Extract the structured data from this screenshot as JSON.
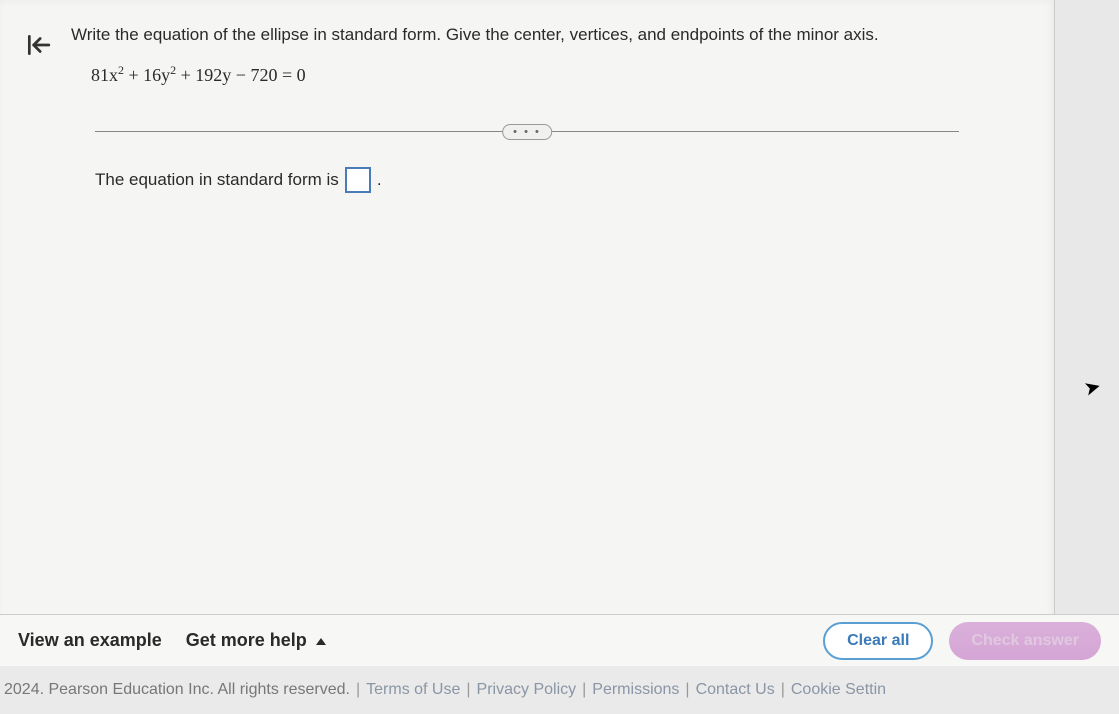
{
  "question": {
    "prompt": "Write the equation of the ellipse in standard form. Give the center, vertices, and endpoints of the minor axis.",
    "equation_html": "81x<span class='sup'>2</span> + 16y<span class='sup'>2</span> + 192y − 720 = 0"
  },
  "answer": {
    "prompt": "The equation in standard form is",
    "suffix": "."
  },
  "toolbar": {
    "view_example": "View an example",
    "get_more_help": "Get more help",
    "clear_all": "Clear all",
    "check_answer": "Check answer"
  },
  "footer": {
    "copyright": "2024. Pearson Education Inc. All rights reserved.",
    "links": {
      "terms": "Terms of Use",
      "privacy": "Privacy Policy",
      "permissions": "Permissions",
      "contact": "Contact Us",
      "cookie": "Cookie Settin"
    }
  },
  "divider": {
    "dots": "• • •"
  }
}
